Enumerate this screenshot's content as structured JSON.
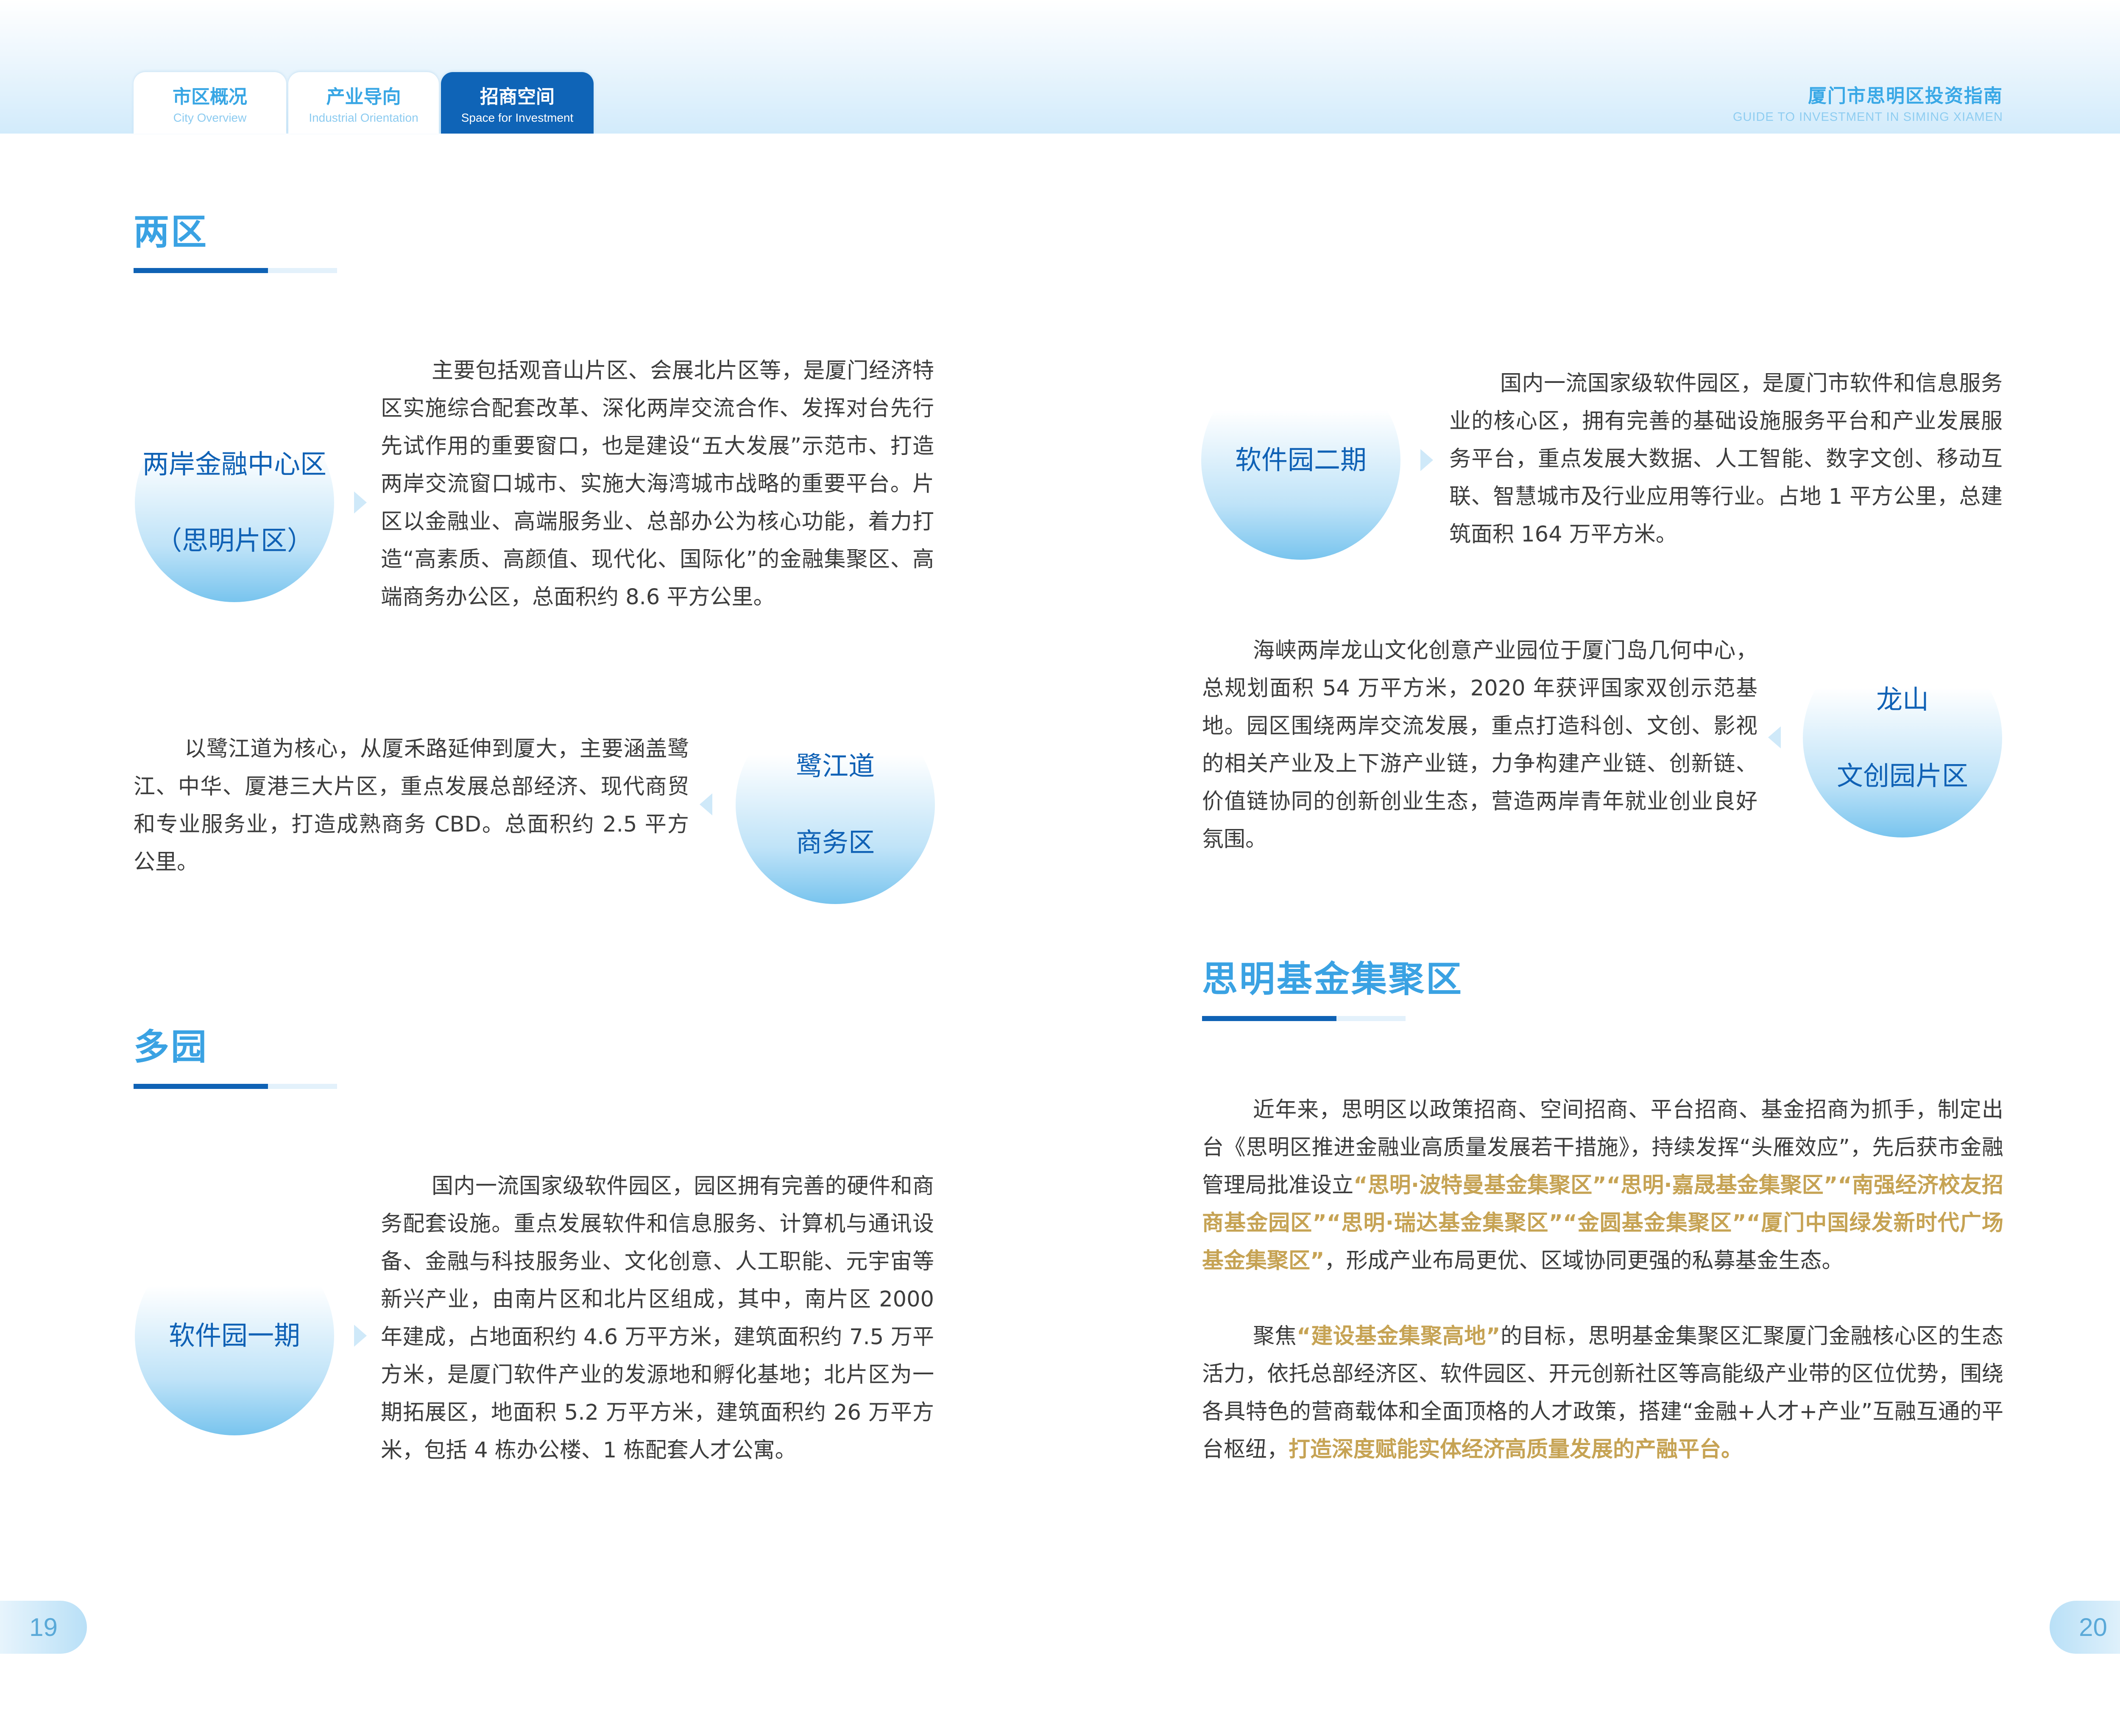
{
  "header": {
    "tabs": [
      {
        "cn": "市区概况",
        "en": "City Overview"
      },
      {
        "cn": "产业导向",
        "en": "Industrial Orientation"
      },
      {
        "cn": "招商空间",
        "en": "Space for Investment"
      }
    ],
    "guide_cn": "厦门市思明区投资指南",
    "guide_en": "GUIDE TO INVESTMENT IN SIMING XIAMEN"
  },
  "left": {
    "section1_title": "两区",
    "block1": {
      "circle_line1": "两岸金融中心区",
      "circle_line2": "（思明片区）",
      "text": "主要包括观音山片区、会展北片区等，是厦门经济特区实施综合配套改革、深化两岸交流合作、发挥对台先行先试作用的重要窗口，也是建设“五大发展”示范市、打造两岸交流窗口城市、实施大海湾城市战略的重要平台。片区以金融业、高端服务业、总部办公为核心功能，着力打造“高素质、高颜值、现代化、国际化”的金融集聚区、高端商务办公区，总面积约 8.6 平方公里。"
    },
    "block2": {
      "circle_line1": "鹭江道",
      "circle_line2": "商务区",
      "text": "以鹭江道为核心，从厦禾路延伸到厦大，主要涵盖鹭江、中华、厦港三大片区，重点发展总部经济、现代商贸和专业服务业，打造成熟商务 CBD。总面积约 2.5 平方公里。"
    },
    "section2_title": "多园",
    "block3": {
      "circle_line1": "软件园一期",
      "text": "国内一流国家级软件园区，园区拥有完善的硬件和商务配套设施。重点发展软件和信息服务、计算机与通讯设备、金融与科技服务业、文化创意、人工职能、元宇宙等新兴产业，由南片区和北片区组成，其中，南片区 2000 年建成，占地面积约 4.6 万平方米，建筑面积约 7.5 万平方米，是厦门软件产业的发源地和孵化基地；北片区为一期拓展区，地面积 5.2 万平方米，建筑面积约 26 万平方米，包括 4 栋办公楼、1 栋配套人才公寓。"
    },
    "page_number": "19"
  },
  "right": {
    "block4": {
      "circle_line1": "软件园二期",
      "text": "国内一流国家级软件园区，是厦门市软件和信息服务业的核心区，拥有完善的基础设施服务平台和产业发展服务平台，重点发展大数据、人工智能、数字文创、移动互联、智慧城市及行业应用等行业。占地 1 平方公里，总建筑面积 164 万平方米。"
    },
    "block5": {
      "circle_line1": "龙山",
      "circle_line2": "文创园片区",
      "text": "海峡两岸龙山文化创意产业园位于厦门岛几何中心，总规划面积 54 万平方米，2020 年获评国家双创示范基地。园区围绕两岸交流发展，重点打造科创、文创、影视的相关产业及上下游产业链，力争构建产业链、创新链、价值链协同的创新创业生态，营造两岸青年就业创业良好氛围。"
    },
    "section3_title": "思明基金集聚区",
    "para1": {
      "t1": "近年来，思明区以政策招商、空间招商、平台招商、基金招商为抓手，制定出台《思明区推进金融业高质量发展若干措施》，持续发挥“头雁效应”，先后获市金融管理局批准设立",
      "h1": "“思明·波特曼基金集聚区”“思明·嘉晟基金集聚区”“南强经济校友招商基金园区”“思明·瑞达基金集聚区”“金圆基金集聚区”“厦门中国绿发新时代广场基金集聚区”",
      "t2": "，形成产业布局更优、区域协同更强的私募基金生态。"
    },
    "para2": {
      "t1": "聚焦",
      "h1": "“建设基金集聚高地”",
      "t2": "的目标，思明基金集聚区汇聚厦门金融核心区的生态活力，依托总部经济区、软件园区、开元创新社区等高能级产业带的区位优势，围绕各具特色的营商载体和全面顶格的人才政策，搭建“金融+人才+产业”互融互通的平台枢纽，",
      "h2": "打造深度赋能实体经济高质量发展的产融平台。"
    },
    "page_number": "20"
  }
}
